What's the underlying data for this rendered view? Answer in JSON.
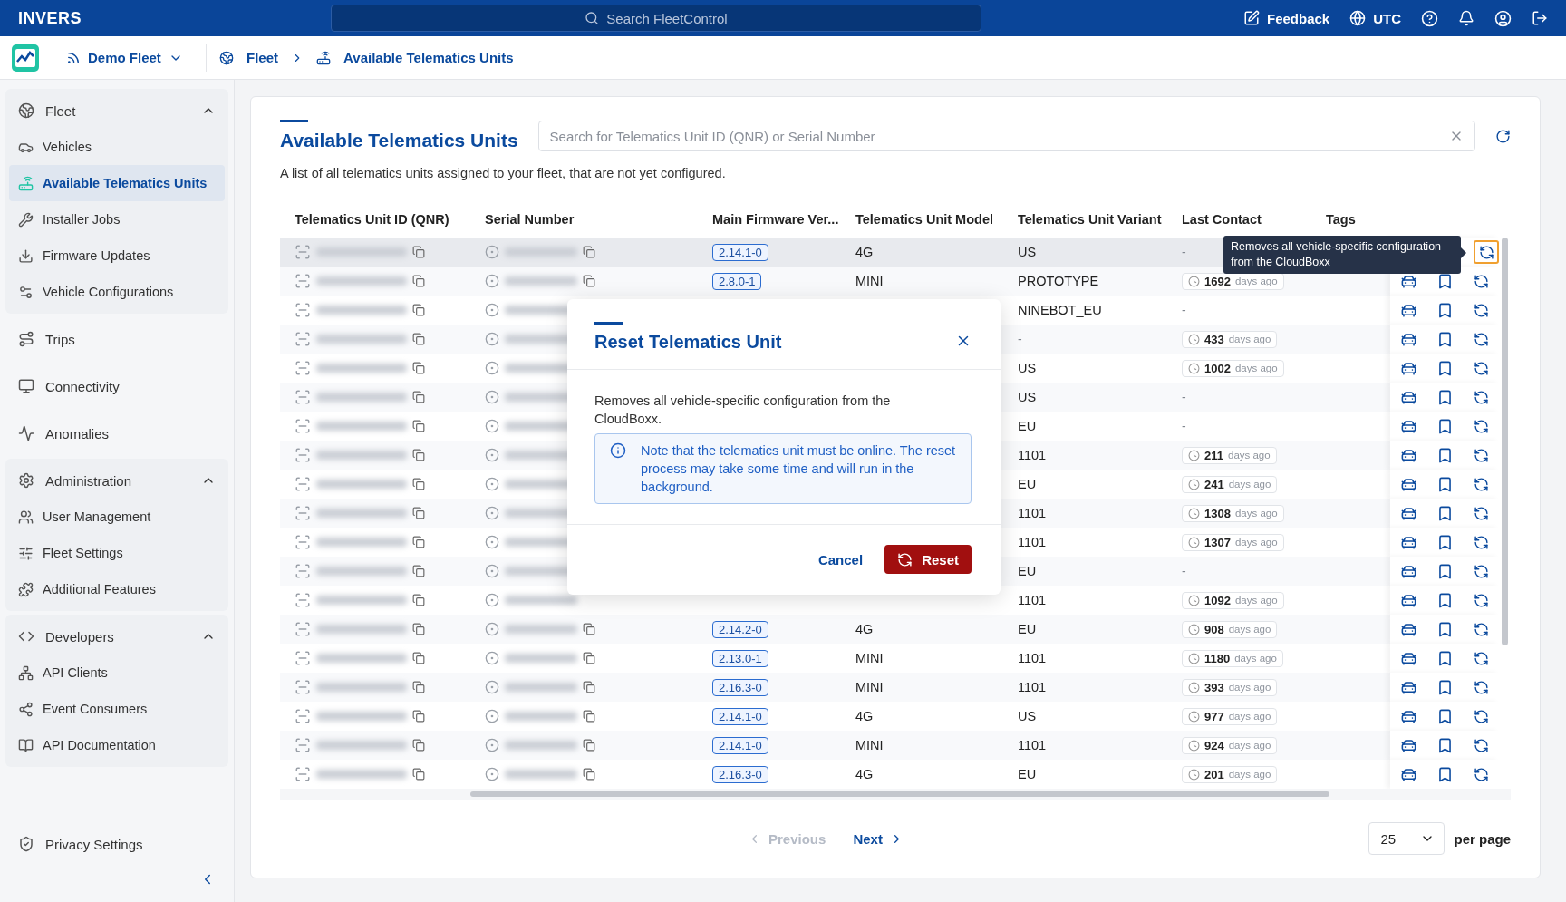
{
  "topbar": {
    "logo": "INVERS",
    "search_placeholder": "Search FleetControl",
    "feedback": "Feedback",
    "timezone": "UTC"
  },
  "subheader": {
    "fleet": "Demo Fleet",
    "breadcrumbs": [
      "Fleet",
      "Available Telematics Units"
    ]
  },
  "sidebar": {
    "sections": [
      {
        "label": "Fleet",
        "kind": "group",
        "expanded": true,
        "items": [
          {
            "label": "Vehicles",
            "selected": false
          },
          {
            "label": "Available Telematics Units",
            "selected": true
          },
          {
            "label": "Installer Jobs",
            "selected": false
          },
          {
            "label": "Firmware Updates",
            "selected": false
          },
          {
            "label": "Vehicle Configurations",
            "selected": false
          }
        ]
      },
      {
        "label": "Trips",
        "kind": "link"
      },
      {
        "label": "Connectivity",
        "kind": "link"
      },
      {
        "label": "Anomalies",
        "kind": "link"
      },
      {
        "label": "Administration",
        "kind": "group",
        "expanded": true,
        "items": [
          {
            "label": "User Management",
            "selected": false
          },
          {
            "label": "Fleet Settings",
            "selected": false
          },
          {
            "label": "Additional Features",
            "selected": false
          }
        ]
      },
      {
        "label": "Developers",
        "kind": "group",
        "expanded": true,
        "items": [
          {
            "label": "API Clients",
            "selected": false
          },
          {
            "label": "Event Consumers",
            "selected": false
          },
          {
            "label": "API Documentation",
            "selected": false
          }
        ]
      }
    ],
    "footer": "Privacy Settings"
  },
  "page": {
    "title": "Available Telematics Units",
    "search_placeholder": "Search for Telematics Unit ID (QNR) or Serial Number",
    "description": "A list of all telematics units assigned to your fleet, that are not yet configured.",
    "columns": [
      "Telematics Unit ID (QNR)",
      "Serial Number",
      "Main Firmware Ver...",
      "Telematics Unit Model",
      "Telematics Unit Variant",
      "Last Contact",
      "Tags"
    ],
    "rows": [
      {
        "highlighted": true,
        "firmware": "2.14.1-0",
        "model": "4G",
        "variant": "US",
        "contact": "-"
      },
      {
        "highlighted": false,
        "firmware": "2.8.0-1",
        "model": "MINI",
        "variant": "PROTOTYPE",
        "contact_days": "1692",
        "contact_unit": "days ago"
      },
      {
        "highlighted": false,
        "variant": "NINEBOT_EU",
        "contact": "-"
      },
      {
        "highlighted": false,
        "variant": "-",
        "contact_days": "433",
        "contact_unit": "days ago"
      },
      {
        "highlighted": false,
        "variant": "US",
        "contact_days": "1002",
        "contact_unit": "days ago"
      },
      {
        "highlighted": false,
        "variant": "US",
        "contact": "-"
      },
      {
        "highlighted": false,
        "variant": "EU",
        "contact": "-"
      },
      {
        "highlighted": false,
        "variant": "1101",
        "contact_days": "211",
        "contact_unit": "days ago"
      },
      {
        "highlighted": false,
        "variant": "EU",
        "contact_days": "241",
        "contact_unit": "days ago"
      },
      {
        "highlighted": false,
        "variant": "1101",
        "contact_days": "1308",
        "contact_unit": "days ago"
      },
      {
        "highlighted": false,
        "variant": "1101",
        "contact_days": "1307",
        "contact_unit": "days ago"
      },
      {
        "highlighted": false,
        "variant": "EU",
        "contact": "-"
      },
      {
        "highlighted": false,
        "variant": "1101",
        "contact_days": "1092",
        "contact_unit": "days ago"
      },
      {
        "highlighted": false,
        "firmware": "2.14.2-0",
        "model": "4G",
        "variant": "EU",
        "contact_days": "908",
        "contact_unit": "days ago"
      },
      {
        "highlighted": false,
        "firmware": "2.13.0-1",
        "model": "MINI",
        "variant": "1101",
        "contact_days": "1180",
        "contact_unit": "days ago"
      },
      {
        "highlighted": false,
        "firmware": "2.16.3-0",
        "model": "MINI",
        "variant": "1101",
        "contact_days": "393",
        "contact_unit": "days ago"
      },
      {
        "highlighted": false,
        "firmware": "2.14.1-0",
        "model": "4G",
        "variant": "US",
        "contact_days": "977",
        "contact_unit": "days ago"
      },
      {
        "highlighted": false,
        "firmware": "2.14.1-0",
        "model": "MINI",
        "variant": "1101",
        "contact_days": "924",
        "contact_unit": "days ago"
      },
      {
        "highlighted": false,
        "firmware": "2.16.3-0",
        "model": "4G",
        "variant": "EU",
        "contact_days": "201",
        "contact_unit": "days ago"
      }
    ],
    "pagination": {
      "previous": "Previous",
      "previous_disabled": true,
      "next": "Next",
      "per_page": "25",
      "per_page_label": "per page"
    }
  },
  "tooltip": "Removes all vehicle-specific configuration from the CloudBoxx",
  "dialog": {
    "title": "Reset Telematics Unit",
    "body": "Removes all vehicle-specific configuration from the CloudBoxx.",
    "note": "Note that the telematics unit must be online. The reset process may take some time and will run in the background.",
    "cancel": "Cancel",
    "confirm": "Reset"
  }
}
